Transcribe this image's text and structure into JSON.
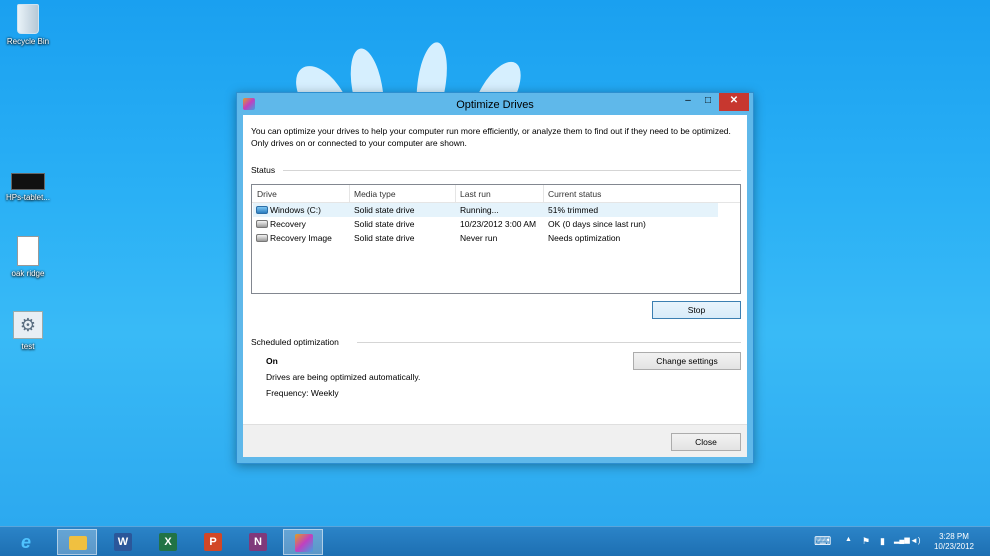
{
  "desktop": {
    "icons": [
      {
        "label": "Recycle Bin",
        "icon": "recycle-bin-icon"
      },
      {
        "label": "HPs-tablet...",
        "icon": "video-file-icon"
      },
      {
        "label": "oak ridge",
        "icon": "document-icon"
      },
      {
        "label": "test",
        "icon": "settings-file-icon"
      }
    ]
  },
  "window": {
    "title": "Optimize Drives",
    "intro": "You can optimize your drives to help your computer run more efficiently, or analyze them to find out if they need to be optimized. Only drives on or connected to your computer are shown.",
    "status_label": "Status",
    "columns": [
      "Drive",
      "Media type",
      "Last run",
      "Current status"
    ],
    "drives": [
      {
        "drive": "Windows (C:)",
        "media": "Solid state drive",
        "last_run": "Running...",
        "status": "51% trimmed",
        "selected": true
      },
      {
        "drive": "Recovery",
        "media": "Solid state drive",
        "last_run": "10/23/2012 3:00 AM",
        "status": "OK (0 days since last run)",
        "selected": false
      },
      {
        "drive": "Recovery Image",
        "media": "Solid state drive",
        "last_run": "Never run",
        "status": "Needs optimization",
        "selected": false
      }
    ],
    "stop_button": "Stop",
    "scheduled_label": "Scheduled optimization",
    "scheduled_state": "On",
    "scheduled_desc": "Drives are being optimized automatically.",
    "frequency": "Frequency: Weekly",
    "change_settings_button": "Change settings",
    "close_button": "Close",
    "controls": {
      "minimize": "–",
      "maximize": "□",
      "close": "✕"
    }
  },
  "taskbar": {
    "apps": [
      {
        "name": "Internet Explorer",
        "icon": "ie-icon",
        "glyph": "e",
        "color": "#1e90ff"
      },
      {
        "name": "File Explorer",
        "icon": "folder-icon",
        "glyph": "",
        "color": "#f0c040",
        "active": true
      },
      {
        "name": "Word",
        "icon": "word-icon",
        "glyph": "W",
        "color": "#2b579a"
      },
      {
        "name": "Excel",
        "icon": "excel-icon",
        "glyph": "X",
        "color": "#217346"
      },
      {
        "name": "PowerPoint",
        "icon": "powerpoint-icon",
        "glyph": "P",
        "color": "#d24726"
      },
      {
        "name": "OneNote",
        "icon": "onenote-icon",
        "glyph": "N",
        "color": "#80397b"
      },
      {
        "name": "Optimize Drives",
        "icon": "optimize-drives-icon",
        "glyph": "",
        "color": "#c060c0",
        "active": true
      }
    ],
    "tray": {
      "keyboard": "⌨",
      "chevron": "▲",
      "flag": "⚑",
      "battery": "▮",
      "network": "▂▄▆",
      "volume": "◄)"
    },
    "time": "3:28 PM",
    "date": "10/23/2012"
  }
}
